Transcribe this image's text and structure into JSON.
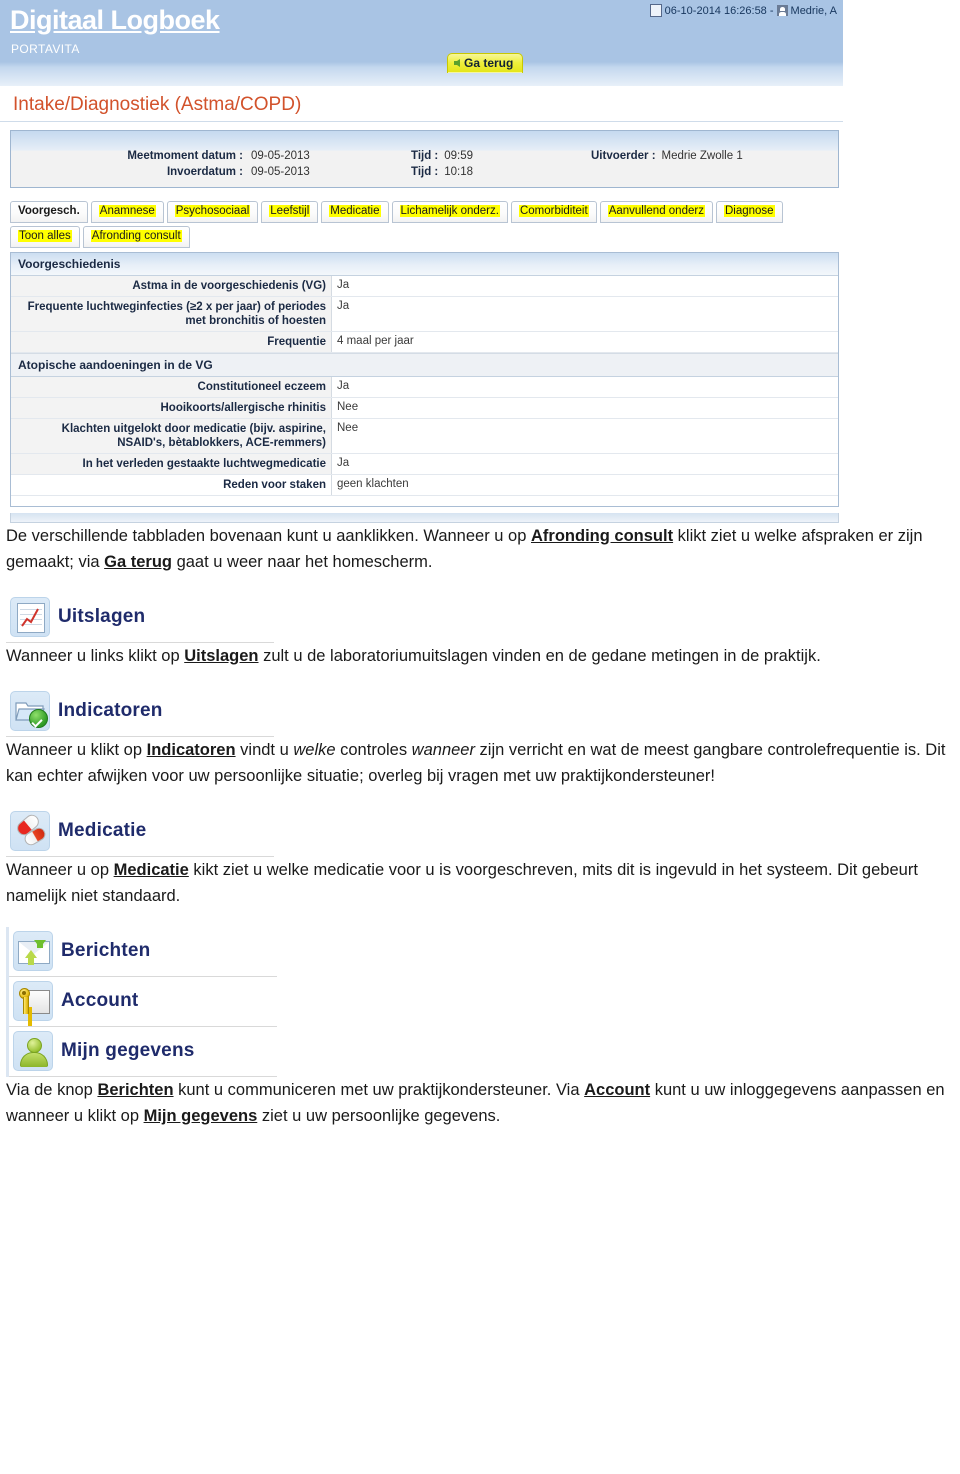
{
  "app": {
    "title": "Digitaal Logboek",
    "subtitle": "PORTAVITA",
    "meta_datetime": "06-10-2014 16:26:58 -",
    "meta_user": "Medrie, A",
    "back_button": "Ga terug",
    "page_title": "Intake/Diagnostiek (Astma/COPD)"
  },
  "visit": {
    "meetmoment_label": "Meetmoment datum :",
    "meetmoment_value": "09-05-2013",
    "invoerdatum_label": "Invoerdatum :",
    "invoerdatum_value": "09-05-2013",
    "tijd_label_1": "Tijd :",
    "tijd_value_1": "09:59",
    "tijd_label_2": "Tijd :",
    "tijd_value_2": "10:18",
    "uitvoerder_label": "Uitvoerder :",
    "uitvoerder_value": "Medrie Zwolle 1"
  },
  "tabs": {
    "row1": [
      {
        "label": "Voorgesch.",
        "active": true,
        "highlight": false
      },
      {
        "label": "Anamnese",
        "active": false,
        "highlight": true
      },
      {
        "label": "Psychosociaal",
        "active": false,
        "highlight": true
      },
      {
        "label": "Leefstijl",
        "active": false,
        "highlight": true
      },
      {
        "label": "Medicatie",
        "active": false,
        "highlight": true
      },
      {
        "label": "Lichamelijk onderz.",
        "active": false,
        "highlight": true
      },
      {
        "label": "Comorbiditeit",
        "active": false,
        "highlight": true
      },
      {
        "label": "Aanvullend onderz",
        "active": false,
        "highlight": true
      },
      {
        "label": "Diagnose",
        "active": false,
        "highlight": true
      }
    ],
    "row2": [
      {
        "label": "Toon alles",
        "active": false,
        "highlight": true
      },
      {
        "label": "Afronding consult",
        "active": false,
        "highlight": true
      }
    ]
  },
  "history": {
    "section1_title": "Voorgeschiedenis",
    "section1_rows": [
      {
        "label": "Astma in de voorgeschiedenis (VG)",
        "value": "Ja"
      },
      {
        "label": "Frequente luchtweginfecties (≥2 x per jaar) of periodes met bronchitis of hoesten",
        "value": "Ja"
      },
      {
        "label": "Frequentie",
        "value": "4 maal per jaar"
      }
    ],
    "section2_title": "Atopische aandoeningen in de VG",
    "section2_rows": [
      {
        "label": "Constitutioneel eczeem",
        "value": "Ja"
      },
      {
        "label": "Hooikoorts/allergische rhinitis",
        "value": "Nee"
      },
      {
        "label": "Klachten uitgelokt door medicatie (bijv. aspirine, NSAID's, bètablokkers, ACE-remmers)",
        "value": "Nee"
      },
      {
        "label": "In het verleden gestaakte luchtwegmedicatie",
        "value": "Ja"
      },
      {
        "label": "Reden voor staken",
        "value": "geen klachten"
      }
    ]
  },
  "doc": {
    "p1": {
      "a": "De verschillende tabbladen bovenaan kunt u aanklikken. Wanneer u op ",
      "b1": "Afronding consult",
      "c": " klikt ziet u welke afspraken er zijn gemaakt; via ",
      "b2": "Ga terug",
      "d": " gaat u weer naar het homescherm."
    },
    "uitslagen": {
      "icon_label": "Uitslagen",
      "a": "Wanneer u links klikt op ",
      "b": "Uitslagen",
      "c": "  zult u de laboratoriumuitslagen vinden en de gedane metingen in de praktijk."
    },
    "indicatoren": {
      "icon_label": "Indicatoren",
      "a": "Wanneer u klikt op ",
      "b": "Indicatoren",
      "c": " vindt u ",
      "i1": "welke",
      "d": " controles ",
      "i2": "wanneer",
      "e": " zijn verricht en wat de meest gangbare controlefrequentie is. Dit kan echter afwijken voor uw persoonlijke situatie; overleg bij vragen met uw praktijkondersteuner!"
    },
    "medicatie": {
      "icon_label": "Medicatie",
      "a": "Wanneer u op ",
      "b": "Medicatie",
      "c": " kikt ziet u welke medicatie voor u is voorgeschreven, mits dit is ingevuld in het systeem. Dit gebeurt namelijk niet standaard."
    },
    "berichten": {
      "icon_label": "Berichten"
    },
    "account": {
      "icon_label": "Account"
    },
    "gegevens": {
      "icon_label": "Mijn gegevens"
    },
    "p_last": {
      "a": "Via de knop ",
      "b1": "Berichten",
      "c": " kunt u communiceren met uw praktijkondersteuner. Via ",
      "b2": "Account",
      "d": " kunt u uw inloggegevens aanpassen en wanneer u klikt op ",
      "b3": "Mijn gegevens",
      "e": " ziet u uw persoonlijke gegevens."
    }
  },
  "colors": {
    "header_blue": "#a9c4e4",
    "title_orange": "#d2522b",
    "highlight_yellow": "#ffff00",
    "icon_label_navy": "#1f2b6b",
    "back_button_yellow": "#eeef3e"
  }
}
